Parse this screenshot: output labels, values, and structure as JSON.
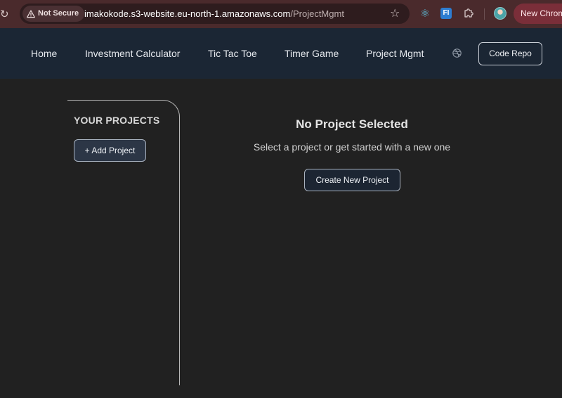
{
  "browser": {
    "security_label": "Not Secure",
    "url_host": "imakokode.s3-website.eu-north-1.amazonaws.com",
    "url_path": "/ProjectMgmt",
    "extension_fi_label": "FI",
    "new_chrome_label": "New Chrom",
    "accent_color": "#7a2e39"
  },
  "nav": {
    "links": [
      "Home",
      "Investment Calculator",
      "Tic Tac Toe",
      "Timer Game",
      "Project Mgmt"
    ],
    "code_repo_label": "Code Repo",
    "background_color": "#1b2634"
  },
  "sidebar": {
    "title": "YOUR PROJECTS",
    "add_project_label": "+ Add Project"
  },
  "main": {
    "empty_title": "No Project Selected",
    "empty_subtitle": "Select a project or get started with a new one",
    "create_label": "Create New Project"
  },
  "icons": {
    "reload": "reload-icon",
    "warning": "warning-icon",
    "bookmark": "star-icon",
    "react_extension": "react-icon",
    "extensions": "puzzle-icon",
    "profile": "avatar",
    "dribbble": "dribbble-icon"
  }
}
